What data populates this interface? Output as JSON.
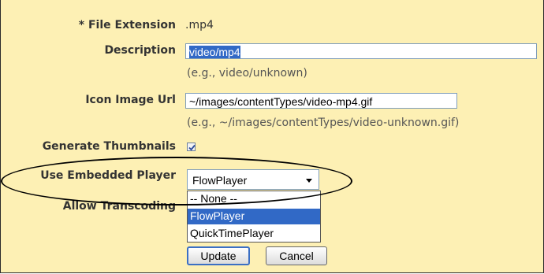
{
  "form": {
    "file_extension": {
      "label": "* File Extension",
      "value": ".mp4"
    },
    "description": {
      "label": "Description",
      "value": "video/mp4",
      "hint": "(e.g., video/unknown)"
    },
    "icon_image_url": {
      "label": "Icon Image Url",
      "value": "~/images/contentTypes/video-mp4.gif",
      "hint": "(e.g., ~/images/contentTypes/video-unknown.gif)"
    },
    "generate_thumbnails": {
      "label": "Generate Thumbnails",
      "checked": true
    },
    "embedded_player": {
      "label": "Use Embedded Player",
      "selected": "FlowPlayer",
      "options": [
        "-- None --",
        "FlowPlayer",
        "QuickTimePlayer"
      ]
    },
    "allow_transcoding": {
      "label": "Allow Transcoding"
    },
    "buttons": {
      "update": "Update",
      "cancel": "Cancel"
    }
  },
  "colors": {
    "panel_bg": "#fdf0b4",
    "selection": "#3169c6",
    "annotation": "#000000"
  }
}
